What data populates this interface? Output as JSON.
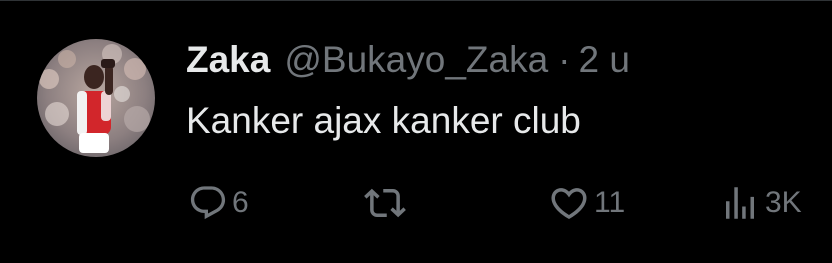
{
  "tweet": {
    "display_name": "Zaka",
    "handle": "@Bukayo_Zaka",
    "separator": "·",
    "timestamp": "2 u",
    "text": "Kanker ajax kanker club",
    "avatar_icon": "profile-photo",
    "actions": {
      "reply": {
        "icon": "reply-icon",
        "count": "6"
      },
      "retweet": {
        "icon": "retweet-icon",
        "count": ""
      },
      "like": {
        "icon": "heart-icon",
        "count": "11"
      },
      "views": {
        "icon": "views-icon",
        "count": "3K"
      }
    }
  },
  "colors": {
    "background": "#000000",
    "primary_text": "#e7e9ea",
    "secondary_text": "#71767b",
    "divider": "#2f3336"
  }
}
